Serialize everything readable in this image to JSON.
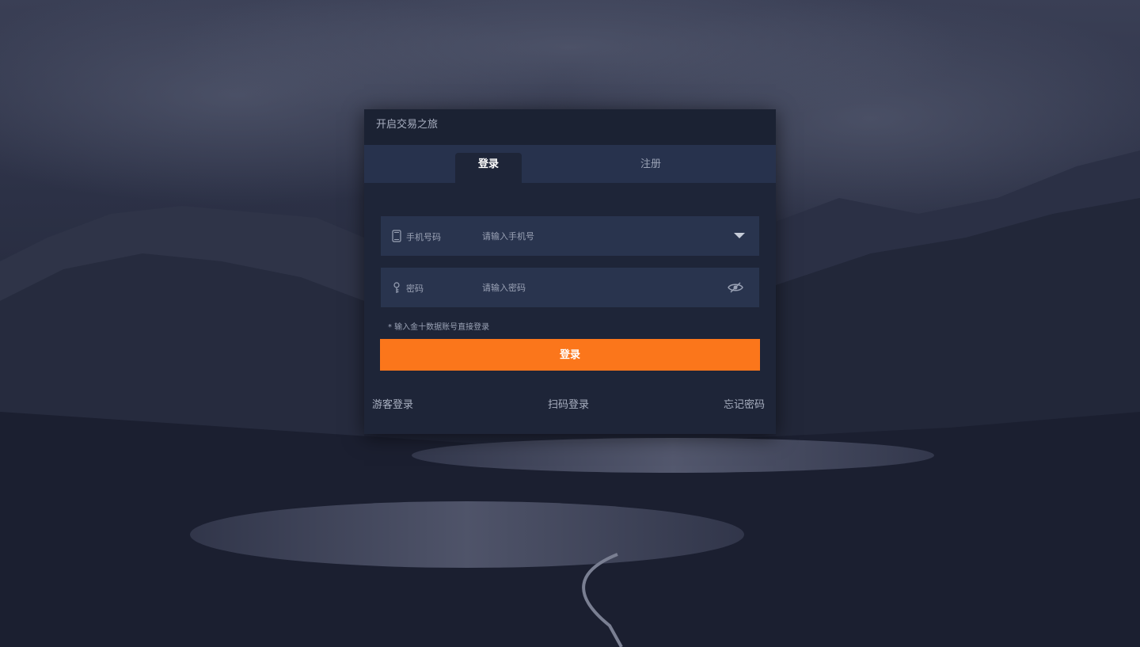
{
  "dialog": {
    "title": "开启交易之旅"
  },
  "tabs": [
    {
      "label": "登录",
      "active": true
    },
    {
      "label": "注册",
      "active": false
    }
  ],
  "phone_field": {
    "icon": "phone-icon",
    "label": "手机号码",
    "placeholder": "请输入手机号",
    "value": ""
  },
  "password_field": {
    "icon": "key-icon",
    "label": "密码",
    "placeholder": "请输入密码",
    "value": ""
  },
  "hint": "* 输入金十数据账号直接登录",
  "login_button": {
    "label": "登录"
  },
  "bottom_links": {
    "guest": "游客登录",
    "qr": "扫码登录",
    "forgot": "忘记密码"
  },
  "colors": {
    "accent": "#fb761b",
    "dialog_bg": "#1e2538",
    "field_bg": "#29344e",
    "tab_bar_bg": "#27324d"
  }
}
